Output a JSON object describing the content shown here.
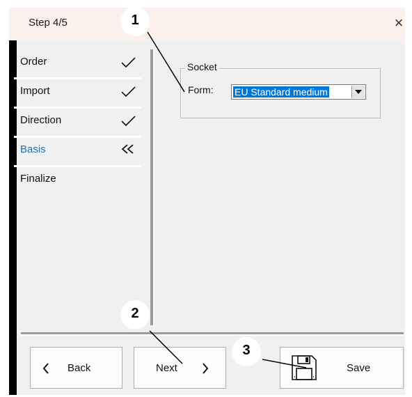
{
  "window": {
    "title": "Step 4/5",
    "close_glyph": "×"
  },
  "nav": {
    "items": [
      {
        "label": "Order",
        "status": "check"
      },
      {
        "label": "Import",
        "status": "check"
      },
      {
        "label": "Direction",
        "status": "check"
      },
      {
        "label": "Basis",
        "status": "current"
      },
      {
        "label": "Finalize",
        "status": "none"
      }
    ]
  },
  "socket": {
    "group_label": "Socket",
    "form_label": "Form:",
    "form_value": "EU Standard medium"
  },
  "buttons": {
    "back": "Back",
    "next": "Next",
    "save": "Save"
  },
  "callouts": [
    "1",
    "2",
    "3"
  ],
  "colors": {
    "active_nav": "#1f6fb5",
    "selection": "#0078d7",
    "titlebar": "#fbf0ec"
  }
}
